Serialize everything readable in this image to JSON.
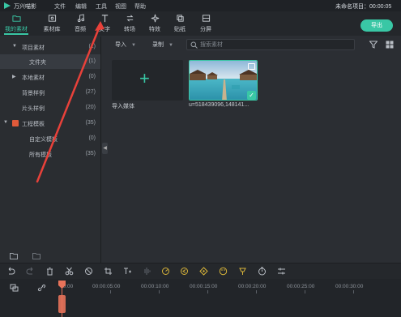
{
  "titlebar": {
    "app_name": "万兴喵影",
    "menu": [
      "文件",
      "编辑",
      "工具",
      "视图",
      "帮助"
    ],
    "project_title": "未命名项目：00:00:05"
  },
  "toolbar": {
    "tabs": [
      {
        "label": "我的素材",
        "icon": "folder-icon",
        "active": true
      },
      {
        "label": "素材库",
        "icon": "library-icon"
      },
      {
        "label": "音频",
        "icon": "music-note-icon"
      },
      {
        "label": "文字",
        "icon": "text-t-icon"
      },
      {
        "label": "转场",
        "icon": "transition-icon"
      },
      {
        "label": "特效",
        "icon": "effects-sparkle-icon"
      },
      {
        "label": "贴纸",
        "icon": "sticker-icon"
      },
      {
        "label": "分屏",
        "icon": "split-screen-icon"
      }
    ],
    "export_label": "导出"
  },
  "sidebar": {
    "items": [
      {
        "name": "项目素材",
        "count": "(1)",
        "expanded": true
      },
      {
        "name": "文件夹",
        "count": "(1)",
        "selected": true
      },
      {
        "name": "本地素材",
        "count": "(0)",
        "expanded": false
      },
      {
        "name": "背景样例",
        "count": "(27)"
      },
      {
        "name": "片头样例",
        "count": "(20)"
      },
      {
        "name": "工程模板",
        "count": "(35)",
        "expanded": true
      },
      {
        "name": "自定义模板",
        "count": "(0)"
      },
      {
        "name": "所有模板",
        "count": "(35)"
      }
    ]
  },
  "content": {
    "import_dropdown": "导入",
    "record_dropdown": "录制",
    "search_placeholder": "搜索素材",
    "import_tile_label": "导入媒体",
    "media_label": "u=518439096,148141..."
  },
  "timeline": {
    "ticks": [
      "00:00",
      "00:00:05:00",
      "00:00:10:00",
      "00:00:15:00",
      "00:00:20:00",
      "00:00:25:00",
      "00:00:30:00"
    ]
  },
  "colors": {
    "accent": "#39c7a5",
    "playhead": "#e8735a",
    "annotation": "#e8413a"
  }
}
